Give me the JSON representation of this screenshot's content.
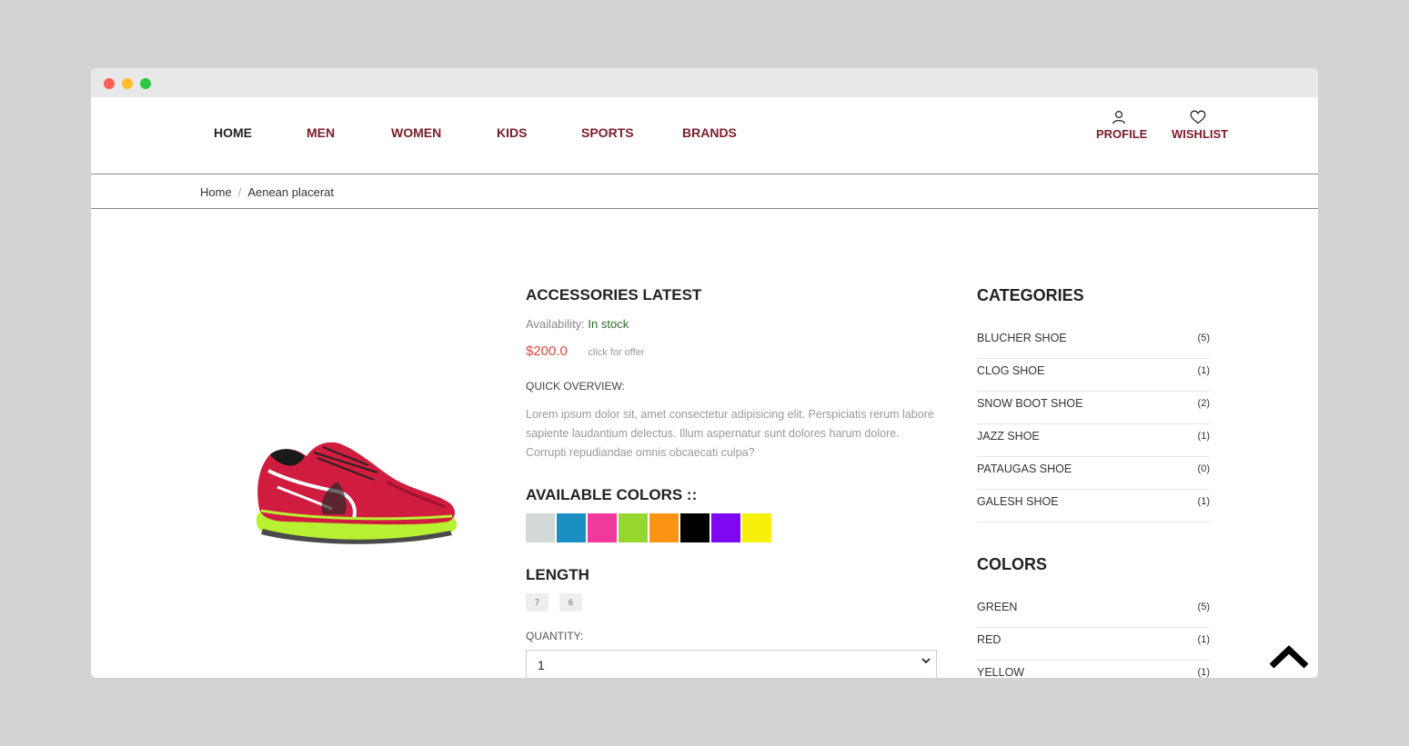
{
  "nav": {
    "items": [
      {
        "label": "HOME"
      },
      {
        "label": "MEN"
      },
      {
        "label": "WOMEN"
      },
      {
        "label": "KIDS"
      },
      {
        "label": "SPORTS"
      },
      {
        "label": "BRANDS"
      }
    ],
    "profile_label": "PROFILE",
    "wishlist_label": "WISHLIST"
  },
  "breadcrumb": {
    "home": "Home",
    "separator": "/",
    "current": "Aenean placerat"
  },
  "product": {
    "title": "ACCESSORIES LATEST",
    "availability_label": "Availability:",
    "availability_value": "In stock",
    "price": "$200.0",
    "offer_text": "click for offer",
    "overview_label": "QUICK OVERVIEW:",
    "overview_text": "Lorem ipsum dolor sit, amet consectetur adipisicing elit. Perspiciatis rerum labore sapiente laudantium delectus. Illum aspernatur sunt dolores harum dolore. Corrupti repudiandae omnis obcaecati culpa?",
    "colors_heading": "AVAILABLE COLORS ::",
    "swatches": [
      "#d4d8d6",
      "#1b8fc2",
      "#f0399b",
      "#96d72f",
      "#fb9414",
      "#000000",
      "#7e09f0",
      "#f6f00a"
    ],
    "length_heading": "LENGTH",
    "sizes": [
      "7",
      "6"
    ],
    "quantity_label": "QUANTITY:",
    "quantity_value": "1"
  },
  "sidebar": {
    "categories_heading": "CATEGORIES",
    "categories": [
      {
        "label": "BLUCHER SHOE",
        "count": "(5)"
      },
      {
        "label": "CLOG SHOE",
        "count": "(1)"
      },
      {
        "label": "SNOW BOOT SHOE",
        "count": "(2)"
      },
      {
        "label": "JAZZ SHOE",
        "count": "(1)"
      },
      {
        "label": "PATAUGAS SHOE",
        "count": "(0)"
      },
      {
        "label": "GALESH SHOE",
        "count": "(1)"
      }
    ],
    "colors_heading": "COLORS",
    "colors": [
      {
        "label": "GREEN",
        "count": "(5)"
      },
      {
        "label": "RED",
        "count": "(1)"
      },
      {
        "label": "YELLOW",
        "count": "(1)"
      }
    ]
  }
}
